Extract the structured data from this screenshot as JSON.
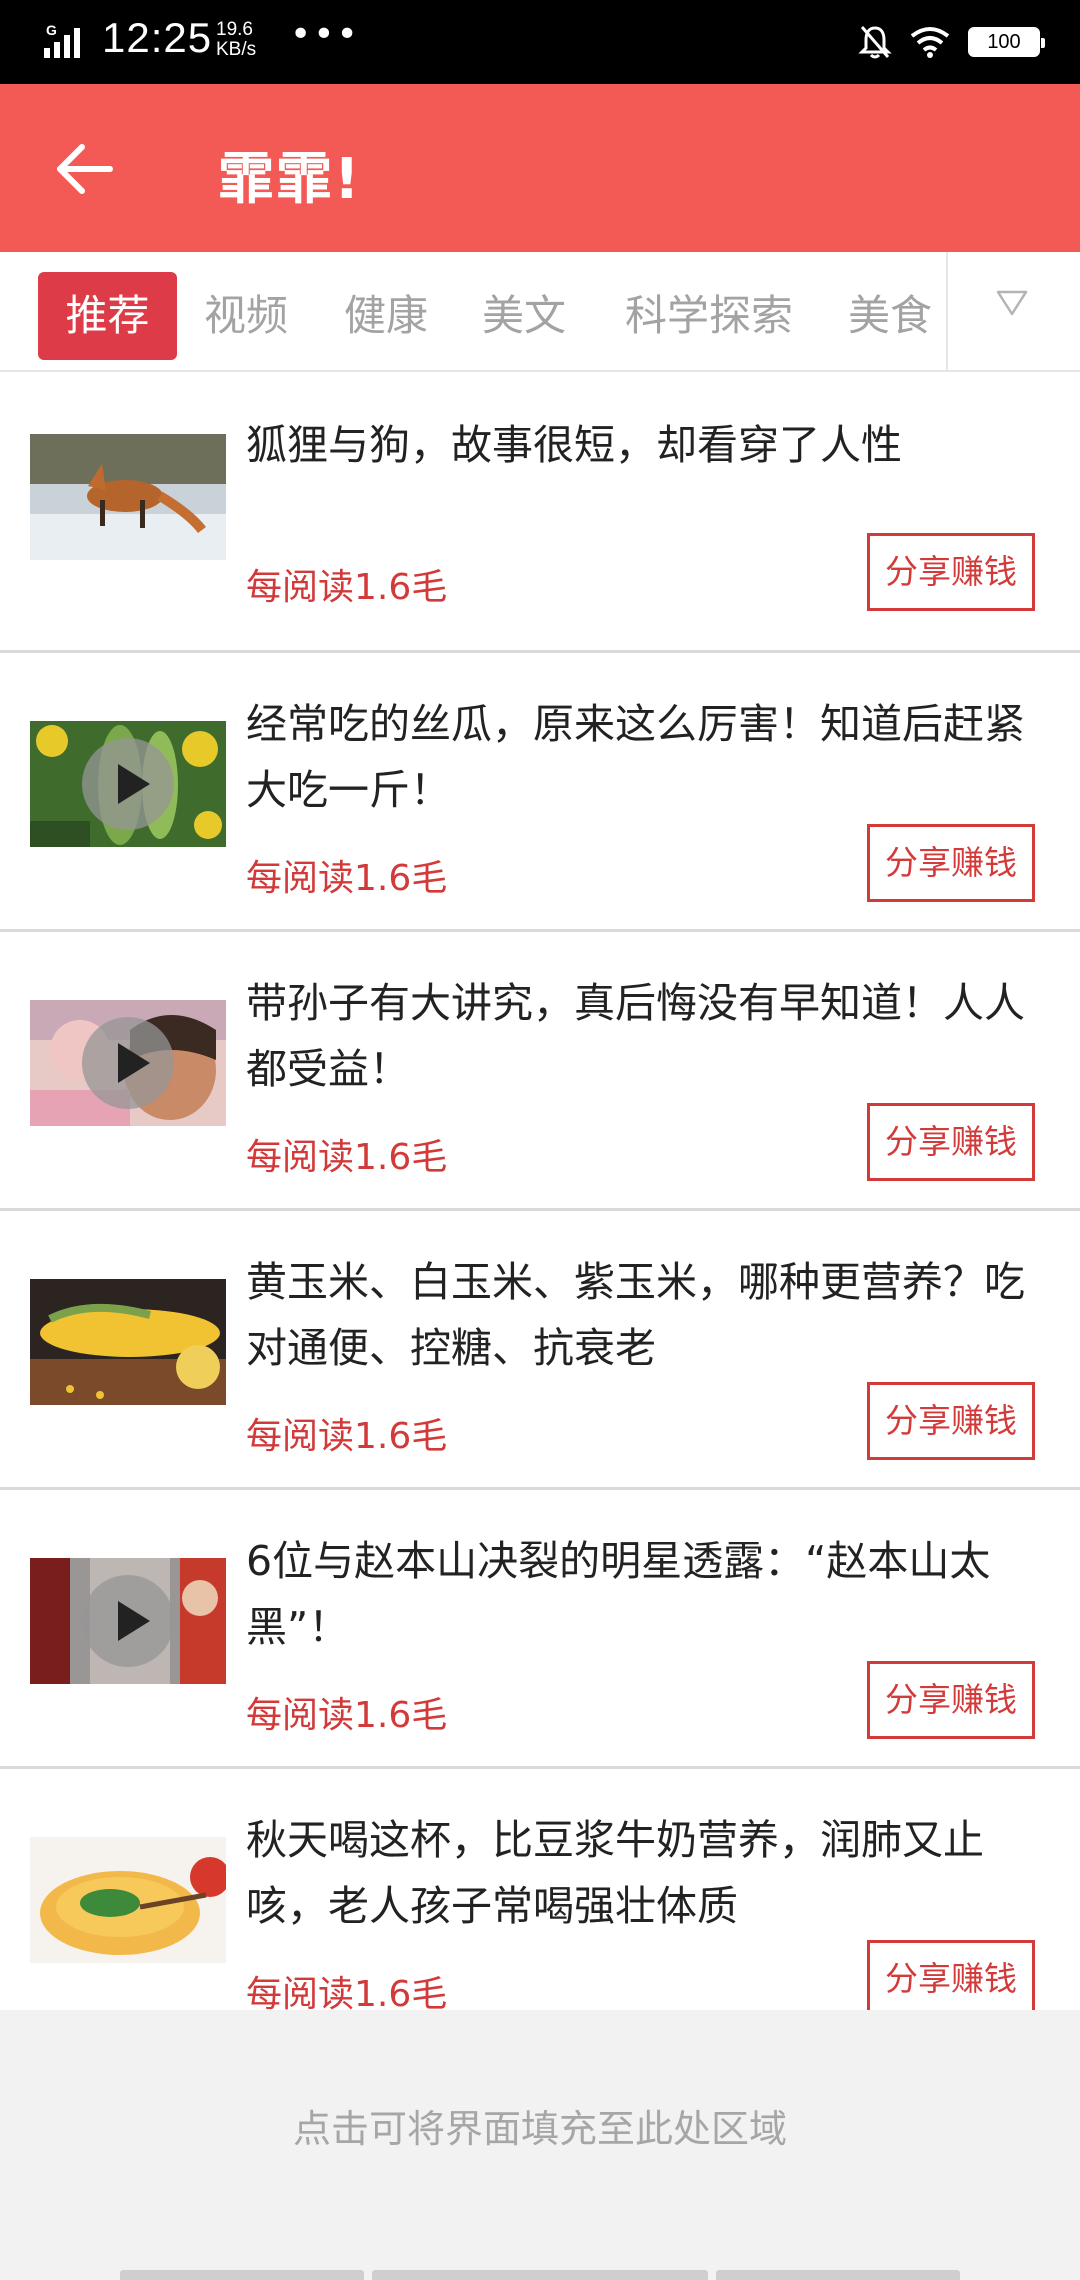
{
  "status_bar": {
    "network": "G",
    "time": "12:25",
    "speed_value": "19.6",
    "speed_unit": "KB/s",
    "dots": "•••",
    "battery": "100"
  },
  "header": {
    "title": "霏霏!"
  },
  "tabs": [
    {
      "label": "推荐",
      "active": true
    },
    {
      "label": "视频",
      "active": false
    },
    {
      "label": "健康",
      "active": false
    },
    {
      "label": "美文",
      "active": false
    },
    {
      "label": "科学探索",
      "active": false
    },
    {
      "label": "美食",
      "active": false
    }
  ],
  "articles": [
    {
      "title": "狐狸与狗，故事很短，却看穿了人性",
      "reward": "每阅读1.6毛",
      "share_label": "分享赚钱",
      "thumb": "fox-in-snow",
      "video": false
    },
    {
      "title": "经常吃的丝瓜，原来这么厉害！知道后赶紧大吃一斤！",
      "reward": "每阅读1.6毛",
      "share_label": "分享赚钱",
      "thumb": "luffa-flowers",
      "video": true
    },
    {
      "title": "带孙子有大讲究，真后悔没有早知道！人人都受益！",
      "reward": "每阅读1.6毛",
      "share_label": "分享赚钱",
      "thumb": "grandmother-baby",
      "video": true
    },
    {
      "title": "黄玉米、白玉米、紫玉米，哪种更营养？吃对通便、控糖、抗衰老",
      "reward": "每阅读1.6毛",
      "share_label": "分享赚钱",
      "thumb": "corn",
      "video": false
    },
    {
      "title": "6位与赵本山决裂的明星透露：“赵本山太黑”！",
      "reward": "每阅读1.6毛",
      "share_label": "分享赚钱",
      "thumb": "people-red",
      "video": true
    },
    {
      "title": "秋天喝这杯，比豆浆牛奶营养，润肺又止咳，老人孩子常喝强壮体质",
      "reward": "每阅读1.6毛",
      "share_label": "分享赚钱",
      "thumb": "orange-drink",
      "video": false
    }
  ],
  "fill_area": {
    "text": "点击可将界面填充至此处区域"
  },
  "colors": {
    "header_bg": "#f45a55",
    "tab_active_bg": "#dc3b47",
    "accent_red": "#d33b3b"
  }
}
